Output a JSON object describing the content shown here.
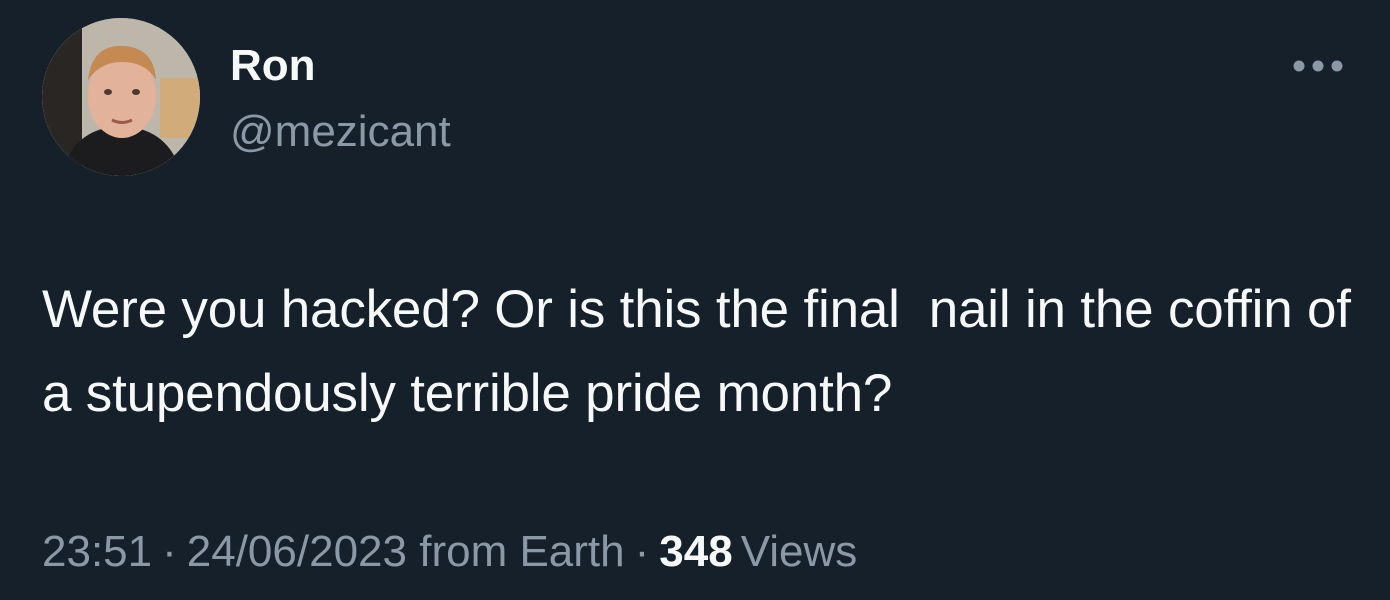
{
  "tweet": {
    "author": {
      "display_name": "Ron",
      "handle": "@mezicant"
    },
    "text": "Were you hacked? Or is this the final  nail in the coffin of a stupendously terrible pride month?",
    "time": "23:51",
    "date": "24/06/2023",
    "source": "from Earth",
    "separator": "·",
    "views_count": "348",
    "views_label": "Views",
    "more_icon": "more-horizontal-icon"
  },
  "colors": {
    "background": "#15202b",
    "primary_text": "#f7f9f9",
    "secondary_text": "#8b98a5"
  }
}
